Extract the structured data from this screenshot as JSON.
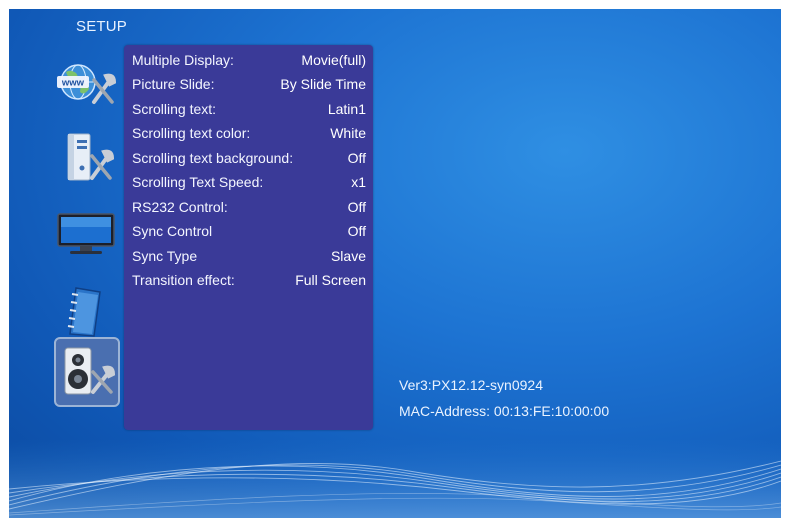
{
  "header": {
    "title": "SETUP"
  },
  "sidebar": {
    "icons": [
      {
        "name": "network-settings-icon",
        "badge_text": "www"
      },
      {
        "name": "pc-settings-icon"
      },
      {
        "name": "display-settings-icon"
      },
      {
        "name": "notebook-settings-icon"
      },
      {
        "name": "audio-settings-icon",
        "selected": true
      }
    ]
  },
  "menu": {
    "items": [
      {
        "label": "Multiple Display:",
        "value": "Movie(full)"
      },
      {
        "label": "Picture Slide:",
        "value": "By Slide Time"
      },
      {
        "label": "Scrolling text:",
        "value": "Latin1"
      },
      {
        "label": "Scrolling text color:",
        "value": "White"
      },
      {
        "label": "Scrolling text background:",
        "value": "Off"
      },
      {
        "label": "Scrolling Text Speed:",
        "value": "x1"
      },
      {
        "label": "RS232 Control:",
        "value": "Off"
      },
      {
        "label": "Sync Control",
        "value": "Off"
      },
      {
        "label": "Sync Type",
        "value": "Slave"
      },
      {
        "label": "Transition effect:",
        "value": "Full Screen"
      }
    ]
  },
  "info": {
    "version": "Ver3:PX12.12-syn0924",
    "mac_address": "MAC-Address: 00:13:FE:10:00:00"
  },
  "colors": {
    "background": "#1d73d2",
    "panel": "#3a3a98",
    "text": "#ffffff"
  }
}
